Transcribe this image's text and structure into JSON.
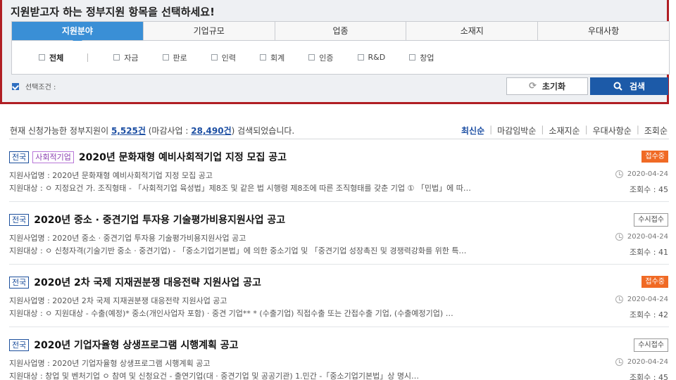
{
  "filter": {
    "title": "지원받고자 하는 정부지원 항목을 선택하세요!",
    "tabs": [
      "지원분야",
      "기업규모",
      "업종",
      "소재지",
      "우대사항"
    ],
    "options": [
      "전체",
      "자금",
      "판로",
      "인력",
      "회계",
      "인증",
      "R&D",
      "창업"
    ],
    "condition_label": "선택조건 :",
    "reset_label": "초기화",
    "search_label": "검색"
  },
  "summary": {
    "prefix": "현재 신청가능한 정부지원이 ",
    "count": "5,525건",
    "middle": " (마감사업 : ",
    "closed": "28,490건",
    "suffix": ") 검색되었습니다."
  },
  "sort": [
    "최신순",
    "마감임박순",
    "소재지순",
    "우대사항순",
    "조회순"
  ],
  "items": [
    {
      "region": "전국",
      "category": "사회적기업",
      "title": "2020년 문화재형 예비사회적기업 지정 모집 공고",
      "project": "지원사업명 : 2020년 문화재형 예비사회적기업 지정 모집 공고",
      "target": "지원대상 : ㅇ 지정요건 가. 조직형태 - 「사회적기업 육성법」제8조 및 같은 법 시행령 제8조에 따른 조직형태를 갖춘 기업 ① 「민법」에 따…",
      "status": "접수중",
      "date": "2020-04-24",
      "views": "조회수 : 45"
    },
    {
      "region": "전국",
      "category": "",
      "title": "2020년 중소 · 중견기업 투자용 기술평가비용지원사업 공고",
      "project": "지원사업명 : 2020년 중소 · 중견기업 투자용 기술평가비용지원사업 공고",
      "target": "지원대상 : ㅇ 신청자격(기술기반 중소 · 중견기업) - 「중소기업기본법」에 의한 중소기업 및 「중견기업 성장촉진 및 경쟁력강화를 위한 특…",
      "status": "수시접수",
      "date": "2020-04-24",
      "views": "조회수 : 41"
    },
    {
      "region": "전국",
      "category": "",
      "title": "2020년 2차 국제 지재권분쟁 대응전략 지원사업 공고",
      "project": "지원사업명 : 2020년 2차 국제 지재권분쟁 대응전략 지원사업 공고",
      "target": "지원대상 : ㅇ 지원대상 - 수출(예정)* 중소(개인사업자 포함) · 중견 기업** * (수출기업) 직접수출 또는 간접수출 기업, (수출예정기업) …",
      "status": "접수중",
      "date": "2020-04-24",
      "views": "조회수 : 42"
    },
    {
      "region": "전국",
      "category": "",
      "title": "2020년 기업자율형 상생프로그램 시행계획 공고",
      "project": "지원사업명 : 2020년 기업자율형 상생프로그램 시행계획 공고",
      "target": "지원대상 : 창업 및 벤처기업 ㅇ 참여 및 신청요건 - 출연기업(대 · 중견기업 및 공공기관) 1.민간 -「중소기업기본법」상 명시…",
      "status": "수시접수",
      "date": "2020-04-24",
      "views": "조회수 : 45"
    }
  ]
}
